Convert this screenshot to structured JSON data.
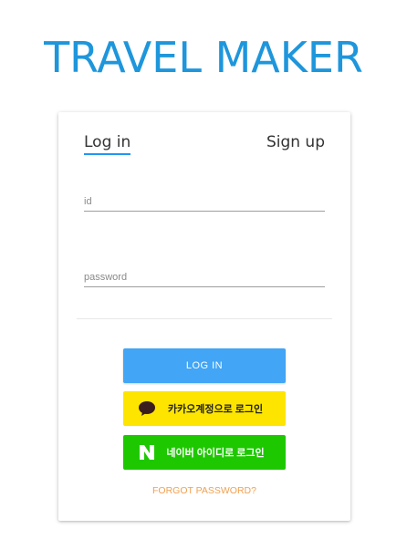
{
  "brand": {
    "title": "TRAVEL MAKER"
  },
  "tabs": {
    "login": "Log in",
    "signup": "Sign up"
  },
  "form": {
    "id_placeholder": "id",
    "id_value": "",
    "password_placeholder": "password",
    "password_value": ""
  },
  "buttons": {
    "login": "LOG IN",
    "kakao": "카카오계정으로 로그인",
    "naver": "네이버 아이디로 로그인"
  },
  "links": {
    "forgot": "FORGOT PASSWORD?"
  },
  "icons": {
    "kakao": "speech-bubble-icon",
    "naver": "naver-n-icon"
  },
  "colors": {
    "brand": "#1e96dc",
    "tab_underline": "#2196f3",
    "login_button": "#42a5f5",
    "kakao_button": "#fee500",
    "naver_button": "#1ec800",
    "forgot_link": "#f0a050"
  }
}
